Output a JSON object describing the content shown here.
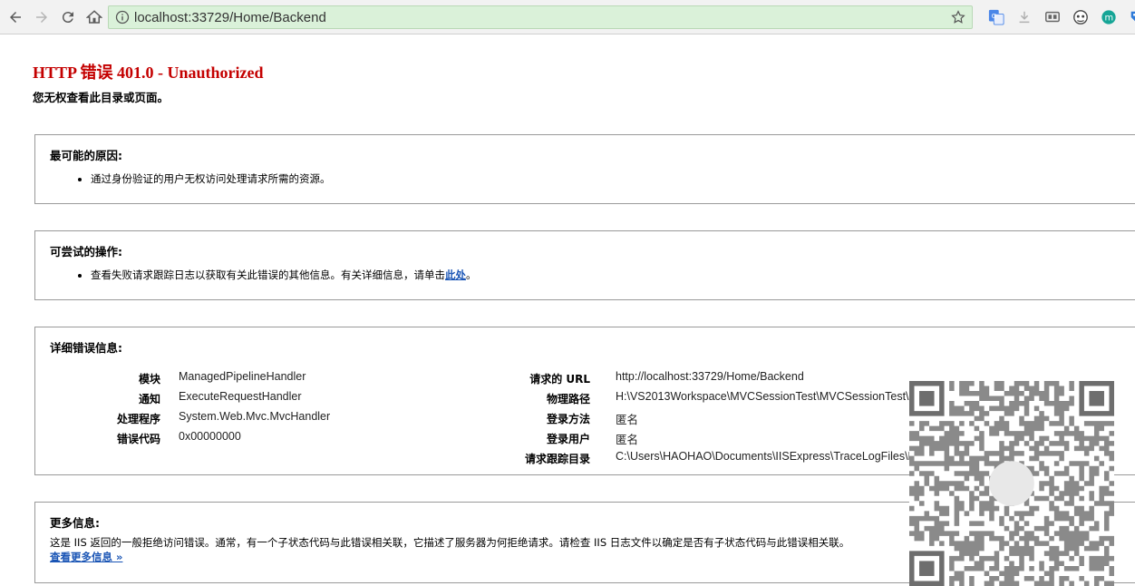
{
  "browser": {
    "url": "localhost:33729/Home/Backend",
    "nav_icons": [
      "back-arrow-icon",
      "forward-arrow-icon",
      "reload-icon",
      "home-icon"
    ],
    "extensions": [
      "translate-icon",
      "download-icon",
      "cast-icon",
      "ghost-icon",
      "m-badge-icon",
      "tag-icon"
    ],
    "colors": {
      "omnibox": "#daf1d9",
      "toolbar": "#f2f2f2"
    }
  },
  "error": {
    "title": "HTTP 错误 401.0 - Unauthorized",
    "subtitle": "您无权查看此目录或页面。",
    "title_color": "#c40000"
  },
  "causes": {
    "heading": "最可能的原因:",
    "items": [
      "通过身份验证的用户无权访问处理请求所需的资源。"
    ]
  },
  "actions": {
    "heading": "可尝试的操作:",
    "item_text": "查看失败请求跟踪日志以获取有关此错误的其他信息。有关详细信息，请单击",
    "item_link": "此处",
    "item_end": "。"
  },
  "details": {
    "heading": "详细错误信息:",
    "left": [
      {
        "label": "模块",
        "value": "ManagedPipelineHandler"
      },
      {
        "label": "通知",
        "value": "ExecuteRequestHandler"
      },
      {
        "label": "处理程序",
        "value": "System.Web.Mvc.MvcHandler"
      },
      {
        "label": "错误代码",
        "value": "0x00000000"
      }
    ],
    "right": [
      {
        "label": "请求的 URL",
        "value": "http://localhost:33729/Home/Backend"
      },
      {
        "label": "物理路径",
        "value": "H:\\VS2013Workspace\\MVCSessionTest\\MVCSessionTest\\Home\\Backend"
      },
      {
        "label": "登录方法",
        "value": "匿名"
      },
      {
        "label": "登录用户",
        "value": "匿名"
      },
      {
        "label": "请求跟踪目录",
        "value": "C:\\Users\\HAOHAO\\Documents\\IISExpress\\TraceLogFiles\\MVCSESSIONTEST"
      }
    ]
  },
  "more": {
    "heading": "更多信息:",
    "text": "这是 IIS 返回的一般拒绝访问错误。通常，有一个子状态代码与此错误相关联，它描述了服务器为何拒绝请求。请检查 IIS 日志文件以确定是否有子状态代码与此错误相关联。",
    "link": "查看更多信息 »"
  }
}
